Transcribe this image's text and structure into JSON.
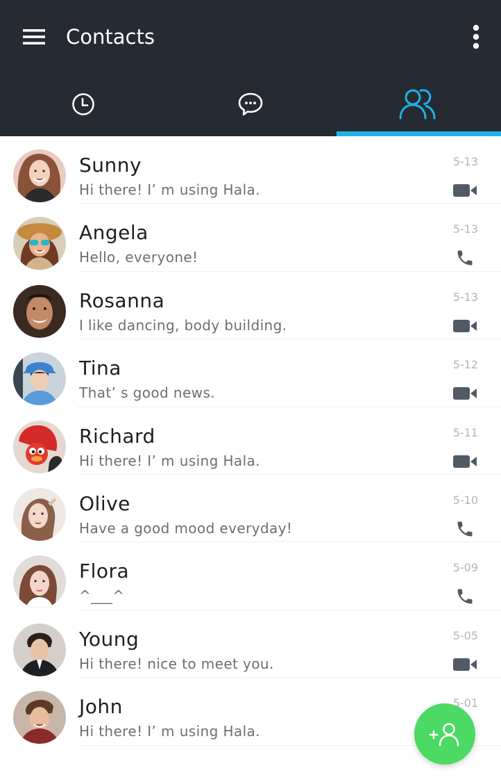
{
  "header": {
    "title": "Contacts",
    "menu_icon": "hamburger-menu-icon",
    "more_icon": "more-vertical-icon",
    "background": "#252a33"
  },
  "tabs": [
    {
      "icon": "clock-icon",
      "active": false
    },
    {
      "icon": "chat-bubble-icon",
      "active": false
    },
    {
      "icon": "contacts-group-icon",
      "active": true
    }
  ],
  "accent_color": "#1fb4e6",
  "contacts": [
    {
      "name": "Sunny",
      "status": "Hi there! I’ m using Hala.",
      "date": "5-13",
      "call_type": "video",
      "call_icon": "video-camera-icon"
    },
    {
      "name": "Angela",
      "status": "Hello, everyone!",
      "date": "5-13",
      "call_type": "voice",
      "call_icon": "phone-icon"
    },
    {
      "name": "Rosanna",
      "status": "I like dancing, body building.",
      "date": "5-13",
      "call_type": "video",
      "call_icon": "video-camera-icon"
    },
    {
      "name": "Tina",
      "status": "That’ s good news.",
      "date": "5-12",
      "call_type": "video",
      "call_icon": "video-camera-icon"
    },
    {
      "name": "Richard",
      "status": "Hi there! I’ m using Hala.",
      "date": "5-11",
      "call_type": "video",
      "call_icon": "video-camera-icon"
    },
    {
      "name": "Olive",
      "status": "Have a good mood everyday!",
      "date": "5-10",
      "call_type": "voice",
      "call_icon": "phone-icon"
    },
    {
      "name": "Flora",
      "status": "^___^",
      "date": "5-09",
      "call_type": "voice",
      "call_icon": "phone-icon"
    },
    {
      "name": "Young",
      "status": "Hi there! nice to meet you.",
      "date": "5-05",
      "call_type": "video",
      "call_icon": "video-camera-icon"
    },
    {
      "name": "John",
      "status": "Hi there! I’ m using Hala.",
      "date": "5-01",
      "call_type": "video",
      "call_icon": "video-camera-icon"
    }
  ],
  "fab": {
    "icon": "add-contact-icon",
    "color": "#4cd964"
  }
}
